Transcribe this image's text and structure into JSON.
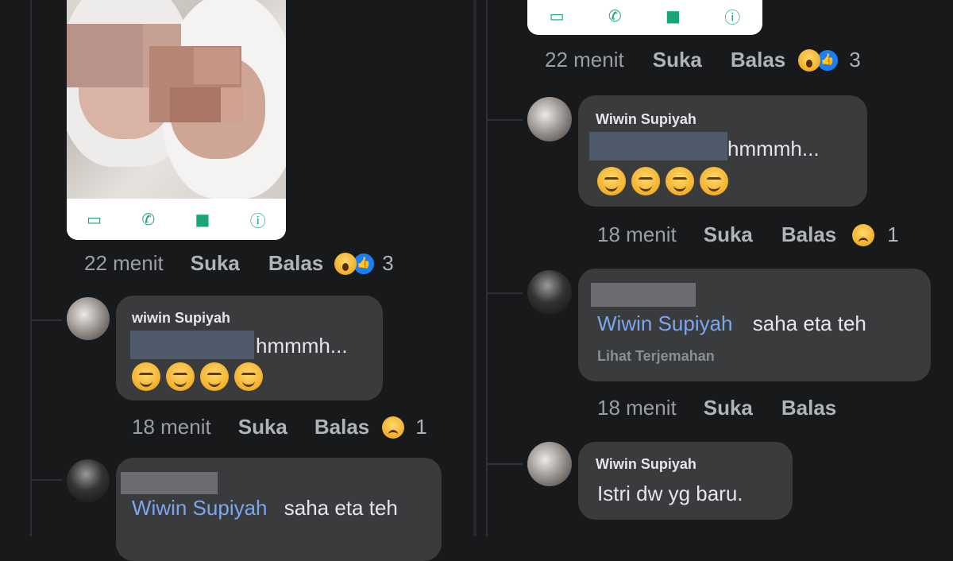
{
  "left": {
    "photo_post": {
      "time": "22 menit",
      "like": "Suka",
      "reply": "Balas",
      "reaction_count": "3",
      "card_icons": [
        "message-icon",
        "phone-icon",
        "video-icon",
        "info-icon"
      ]
    },
    "comment1": {
      "name": "wiwin Supiyah",
      "text": "hmmmh...",
      "time": "18 menit",
      "like": "Suka",
      "reply": "Balas",
      "reaction_count": "1"
    },
    "comment2": {
      "mention": "Wiwin Supiyah",
      "text": "saha eta teh"
    }
  },
  "right": {
    "photo_post": {
      "time": "22 menit",
      "like": "Suka",
      "reply": "Balas",
      "reaction_count": "3"
    },
    "comment1": {
      "name": "Wiwin Supiyah",
      "text": "hmmmh...",
      "time": "18 menit",
      "like": "Suka",
      "reply": "Balas",
      "reaction_count": "1"
    },
    "comment2": {
      "mention": "Wiwin Supiyah",
      "text": "saha eta teh",
      "translate": "Lihat Terjemahan",
      "time": "18 menit",
      "like": "Suka",
      "reply": "Balas"
    },
    "comment3": {
      "name": "Wiwin Supiyah",
      "text": "Istri dw yg baru."
    }
  },
  "colors": {
    "background": "#18191b",
    "bubble": "#3a3b3c",
    "mention": "#7aa7ee",
    "card_icon": "#18a57a"
  }
}
